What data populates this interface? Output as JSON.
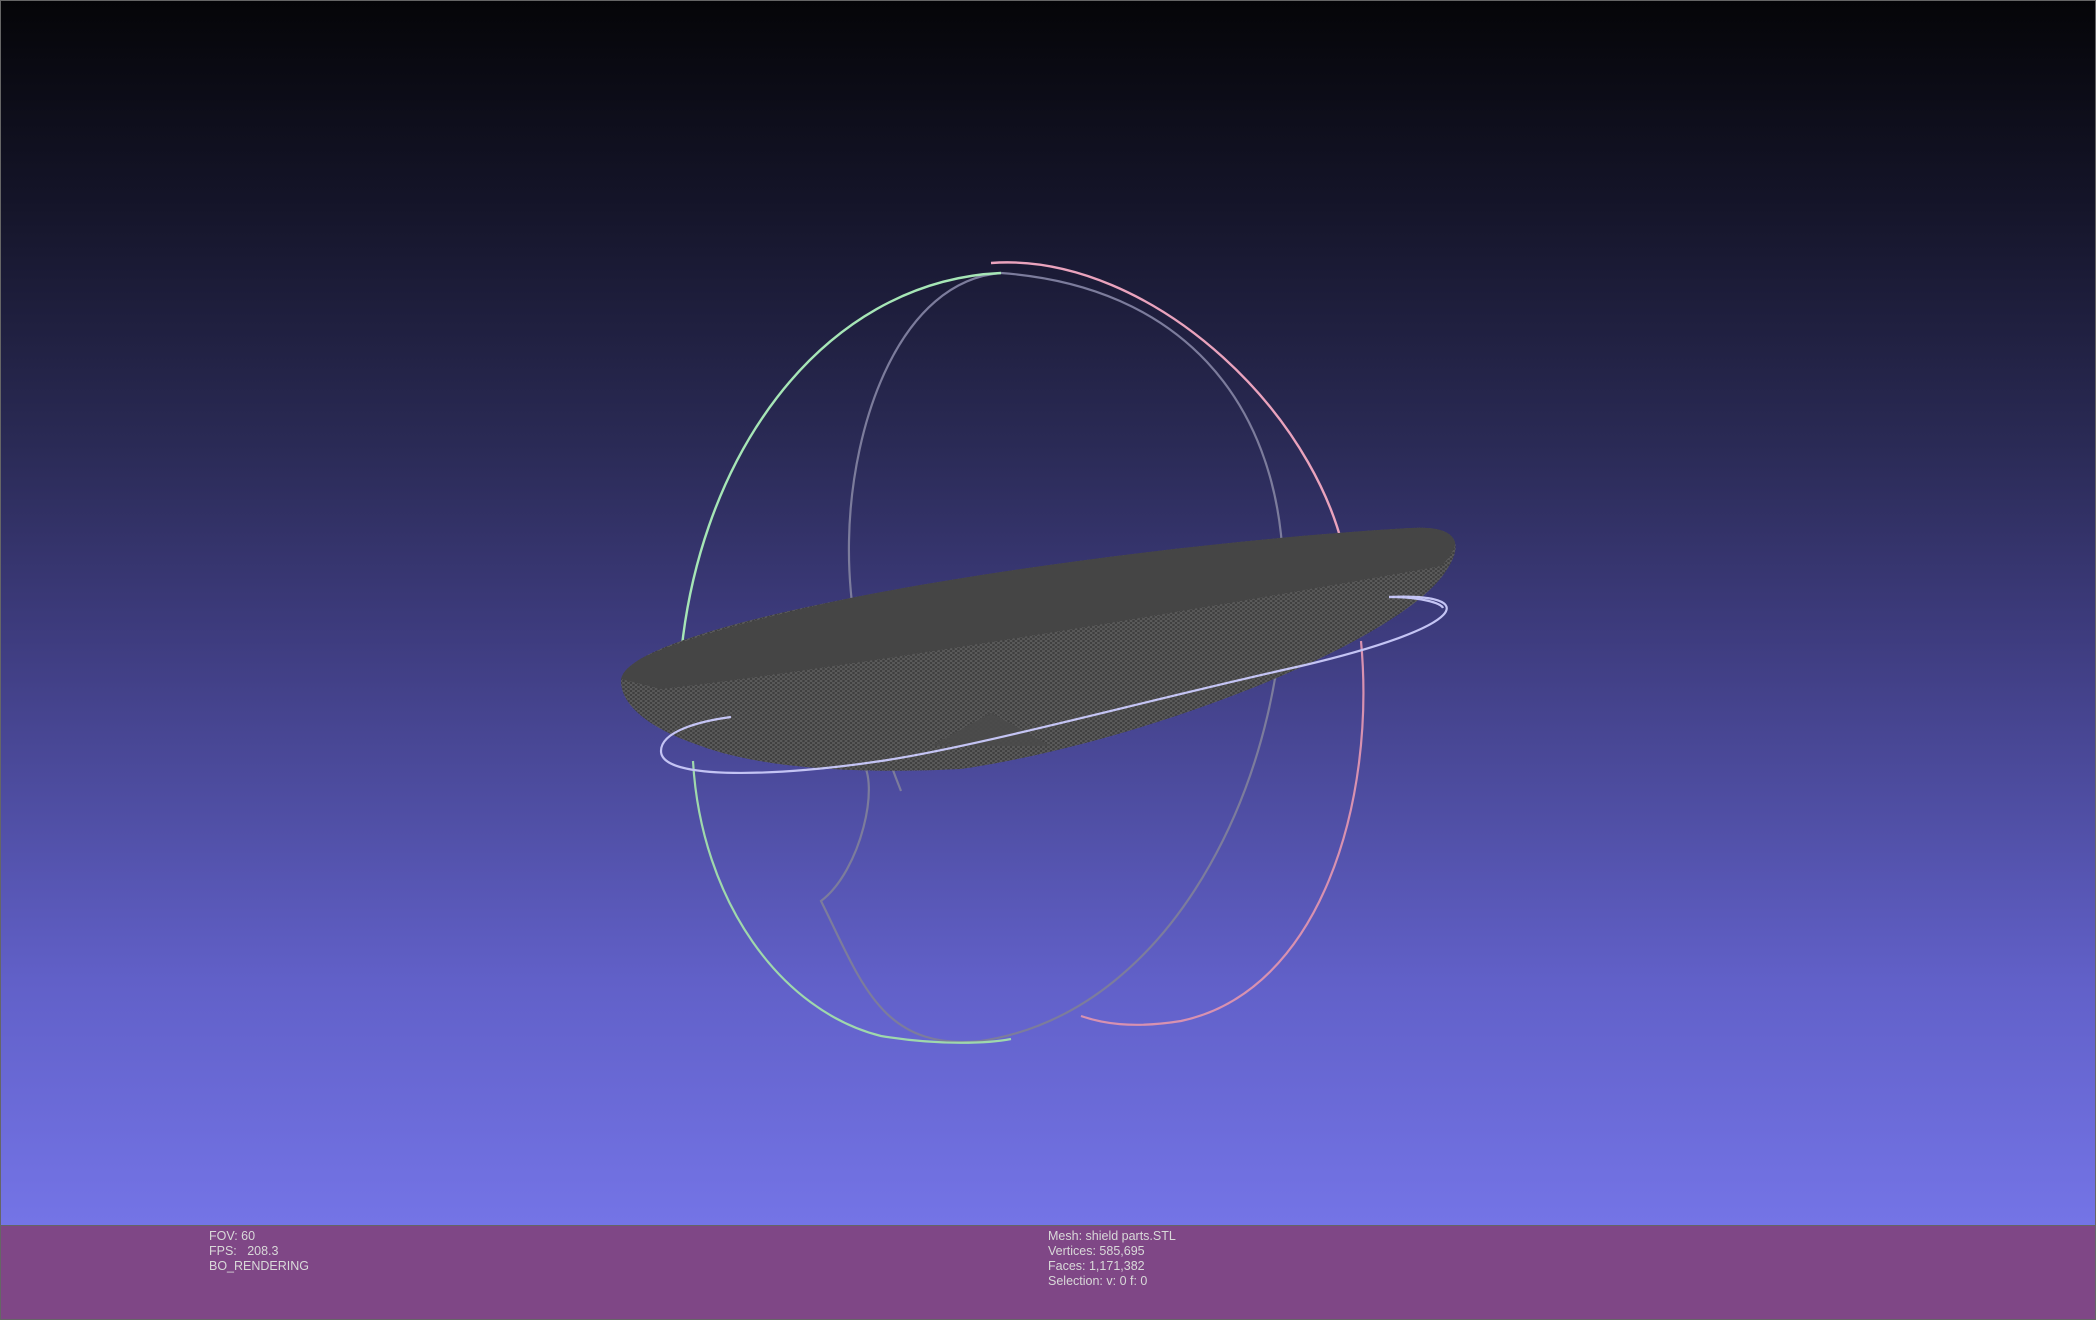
{
  "viewport": {
    "background_gradient": [
      "#050508",
      "#2a2a55",
      "#4f4ea3",
      "#7474e6"
    ],
    "mesh_color": "#444444",
    "trackball_colors": {
      "x_ring": "#e8a0b8",
      "y_ring": "#9fe0b0",
      "z_ring": "#b8b8f0",
      "back_ring": "#7a7a9a"
    }
  },
  "info_bar": {
    "background": "#7f4786",
    "left": {
      "fov": "FOV: 60",
      "fps": "FPS:   208.3",
      "mode": "BO_RENDERING"
    },
    "right": {
      "mesh": "Mesh: shield parts.STL",
      "vertices": "Vertices: 585,695",
      "faces": "Faces: 1,171,382",
      "selection": "Selection: v: 0 f: 0"
    }
  }
}
